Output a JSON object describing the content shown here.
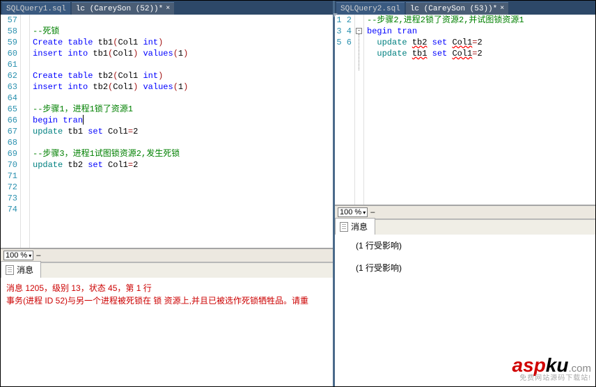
{
  "left": {
    "tabs": [
      {
        "label": "SQLQuery1.sql",
        "active": false
      },
      {
        "label": "lc (CareySon (52))*",
        "active": true
      }
    ],
    "line_start": 57,
    "lines": [
      {
        "n": 57,
        "seg": []
      },
      {
        "n": 58,
        "seg": [
          {
            "cls": "cmt",
            "t": "--死锁"
          }
        ]
      },
      {
        "n": 59,
        "seg": [
          {
            "cls": "kw",
            "t": "Create "
          },
          {
            "cls": "kw",
            "t": "table"
          },
          {
            "cls": "txt",
            "t": " tb1"
          },
          {
            "cls": "str",
            "t": "("
          },
          {
            "cls": "txt",
            "t": "Col1 "
          },
          {
            "cls": "kw",
            "t": "int"
          },
          {
            "cls": "str",
            "t": ")"
          }
        ]
      },
      {
        "n": 60,
        "seg": [
          {
            "cls": "kw",
            "t": "insert "
          },
          {
            "cls": "kw",
            "t": "into"
          },
          {
            "cls": "txt",
            "t": " tb1"
          },
          {
            "cls": "str",
            "t": "("
          },
          {
            "cls": "txt",
            "t": "Col1"
          },
          {
            "cls": "str",
            "t": ")"
          },
          {
            "cls": "txt",
            "t": " "
          },
          {
            "cls": "kw",
            "t": "values"
          },
          {
            "cls": "str",
            "t": "("
          },
          {
            "cls": "txt",
            "t": "1"
          },
          {
            "cls": "str",
            "t": ")"
          }
        ]
      },
      {
        "n": 61,
        "seg": []
      },
      {
        "n": 62,
        "seg": [
          {
            "cls": "kw",
            "t": "Create "
          },
          {
            "cls": "kw",
            "t": "table"
          },
          {
            "cls": "txt",
            "t": " tb2"
          },
          {
            "cls": "str",
            "t": "("
          },
          {
            "cls": "txt",
            "t": "Col1 "
          },
          {
            "cls": "kw",
            "t": "int"
          },
          {
            "cls": "str",
            "t": ")"
          }
        ]
      },
      {
        "n": 63,
        "seg": [
          {
            "cls": "kw",
            "t": "insert "
          },
          {
            "cls": "kw",
            "t": "into"
          },
          {
            "cls": "txt",
            "t": " tb2"
          },
          {
            "cls": "str",
            "t": "("
          },
          {
            "cls": "txt",
            "t": "Col1"
          },
          {
            "cls": "str",
            "t": ")"
          },
          {
            "cls": "txt",
            "t": " "
          },
          {
            "cls": "kw",
            "t": "values"
          },
          {
            "cls": "str",
            "t": "("
          },
          {
            "cls": "txt",
            "t": "1"
          },
          {
            "cls": "str",
            "t": ")"
          }
        ]
      },
      {
        "n": 64,
        "seg": []
      },
      {
        "n": 65,
        "seg": [
          {
            "cls": "cmt",
            "t": "--步骤1，进程1锁了资源1"
          }
        ]
      },
      {
        "n": 66,
        "seg": [
          {
            "cls": "kw",
            "t": "begin "
          },
          {
            "cls": "kw",
            "t": "tran"
          },
          {
            "cls": "caret",
            "t": ""
          }
        ]
      },
      {
        "n": 67,
        "seg": [
          {
            "cls": "sys",
            "t": "update"
          },
          {
            "cls": "txt",
            "t": " tb1 "
          },
          {
            "cls": "kw",
            "t": "set"
          },
          {
            "cls": "txt",
            "t": " Col1"
          },
          {
            "cls": "str",
            "t": "="
          },
          {
            "cls": "txt",
            "t": "2"
          }
        ]
      },
      {
        "n": 68,
        "seg": []
      },
      {
        "n": 69,
        "seg": [
          {
            "cls": "cmt",
            "t": "--步骤3，进程1试图锁资源2,发生死锁"
          }
        ]
      },
      {
        "n": 70,
        "seg": [
          {
            "cls": "sys",
            "t": "update"
          },
          {
            "cls": "txt",
            "t": " tb2 "
          },
          {
            "cls": "kw",
            "t": "set"
          },
          {
            "cls": "txt",
            "t": " Col1"
          },
          {
            "cls": "str",
            "t": "="
          },
          {
            "cls": "txt",
            "t": "2"
          }
        ]
      },
      {
        "n": 71,
        "seg": []
      },
      {
        "n": 72,
        "seg": []
      },
      {
        "n": 73,
        "seg": []
      },
      {
        "n": 74,
        "seg": []
      }
    ],
    "zoom": "100 %",
    "msg_tab": "消息",
    "messages": [
      "消息 1205，级别 13，状态 45，第 1 行",
      "事务(进程 ID 52)与另一个进程被死锁在 锁 资源上,并且已被选作死锁牺牲品。请重"
    ]
  },
  "right": {
    "tabs": [
      {
        "label": "SQLQuery2.sql",
        "active": false
      },
      {
        "label": "lc (CareySon (53))*",
        "active": true
      }
    ],
    "lines": [
      {
        "n": 1,
        "seg": [
          {
            "cls": "cmt",
            "t": "--步骤2,进程2锁了资源2,并试图锁资源1"
          }
        ]
      },
      {
        "n": 2,
        "seg": [
          {
            "cls": "kw",
            "t": "begin "
          },
          {
            "cls": "kw",
            "t": "tran"
          }
        ],
        "fold": "minus"
      },
      {
        "n": 3,
        "indent": "  ",
        "seg": [
          {
            "cls": "sys",
            "t": "update"
          },
          {
            "cls": "txt",
            "t": " "
          },
          {
            "cls": "txt squig",
            "t": "tb2"
          },
          {
            "cls": "txt",
            "t": " "
          },
          {
            "cls": "kw",
            "t": "set"
          },
          {
            "cls": "txt",
            "t": " "
          },
          {
            "cls": "txt squig",
            "t": "Col1"
          },
          {
            "cls": "str",
            "t": "="
          },
          {
            "cls": "txt",
            "t": "2"
          }
        ]
      },
      {
        "n": 4,
        "indent": "  ",
        "seg": [
          {
            "cls": "sys",
            "t": "update"
          },
          {
            "cls": "txt",
            "t": " "
          },
          {
            "cls": "txt squig",
            "t": "tb1"
          },
          {
            "cls": "txt",
            "t": " "
          },
          {
            "cls": "kw",
            "t": "set"
          },
          {
            "cls": "txt",
            "t": " "
          },
          {
            "cls": "txt squig",
            "t": "Col1"
          },
          {
            "cls": "str",
            "t": "="
          },
          {
            "cls": "txt",
            "t": "2"
          }
        ]
      },
      {
        "n": 5,
        "seg": []
      },
      {
        "n": 6,
        "seg": []
      }
    ],
    "zoom": "100 %",
    "msg_tab": "消息",
    "messages_ok": [
      "(1 行受影响)",
      "(1 行受影响)"
    ]
  },
  "watermark": {
    "asp": "asp",
    "ku": "ku",
    "com": ".com",
    "sub": "免费网站源码下载站!"
  }
}
